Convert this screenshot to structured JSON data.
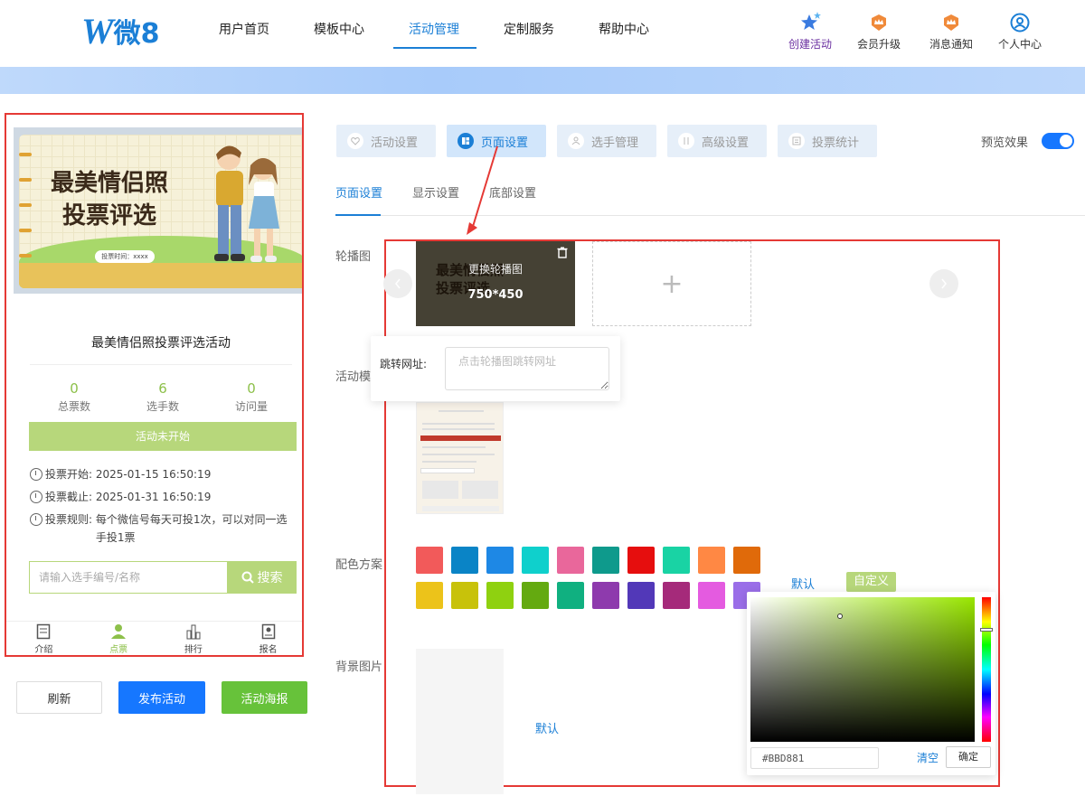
{
  "logo": {
    "letter": "W",
    "text": "微8"
  },
  "nav": [
    "用户首页",
    "模板中心",
    "活动管理",
    "定制服务",
    "帮助中心"
  ],
  "tools": [
    {
      "label": "创建活动",
      "icon": "star-sparkle-icon"
    },
    {
      "label": "会员升级",
      "icon": "crown-badge-icon"
    },
    {
      "label": "消息通知",
      "icon": "bell-badge-icon"
    },
    {
      "label": "个人中心",
      "icon": "user-circle-icon"
    }
  ],
  "preview": {
    "cover_title_line1": "最美情侣照",
    "cover_title_line2": "投票评选",
    "cover_chip": "投票时间：xxxx",
    "activity_title": "最美情侣照投票评选活动",
    "stats": [
      {
        "num": "0",
        "cap": "总票数"
      },
      {
        "num": "6",
        "cap": "选手数"
      },
      {
        "num": "0",
        "cap": "访问量"
      }
    ],
    "status_button": "活动未开始",
    "vote_start_label": "投票开始:",
    "vote_start": "2025-01-15 16:50:19",
    "vote_end_label": "投票截止:",
    "vote_end": "2025-01-31 16:50:19",
    "rule_label": "投票规则:",
    "rule_text": "每个微信号每天可投1次，可以对同一选手投1票",
    "search_placeholder": "请输入选手编号/名称",
    "search_button": "搜索",
    "tabs": [
      "介绍",
      "点票",
      "排行",
      "报名"
    ]
  },
  "actions": {
    "refresh": "刷新",
    "publish": "发布活动",
    "poster": "活动海报"
  },
  "steps": [
    "活动设置",
    "页面设置",
    "选手管理",
    "高级设置",
    "投票统计"
  ],
  "preview_toggle_label": "预览效果",
  "subtabs": [
    "页面设置",
    "显示设置",
    "底部设置"
  ],
  "fields": {
    "carousel": "轮播图",
    "template": "活动模",
    "color_scheme": "配色方案",
    "background": "背景图片"
  },
  "carousel": {
    "change_label": "更换轮播图",
    "size": "750*450",
    "slide_line1": "最美情侣照",
    "slide_line2": "投票评选",
    "add_symbol": "+",
    "jump_label": "跳转网址:",
    "jump_placeholder": "点击轮播图跳转网址"
  },
  "swatches": [
    "#f25a5a",
    "#0a84c6",
    "#1e88e5",
    "#0fd0cc",
    "#e9679b",
    "#0e9a8c",
    "#e60e0e",
    "#19d3a4",
    "#ff8844",
    "#e06a0a",
    "#ecc31a",
    "#c8c20a",
    "#8fd110",
    "#64aa10",
    "#10b080",
    "#8e3aad",
    "#5238b8",
    "#a52a7a",
    "#e45be0",
    "#9a6ee8"
  ],
  "scheme": {
    "default": "默认",
    "custom": "自定义"
  },
  "background": {
    "default": "默认"
  },
  "picker": {
    "hex": "#BBD881",
    "clear": "清空",
    "confirm": "确定"
  }
}
